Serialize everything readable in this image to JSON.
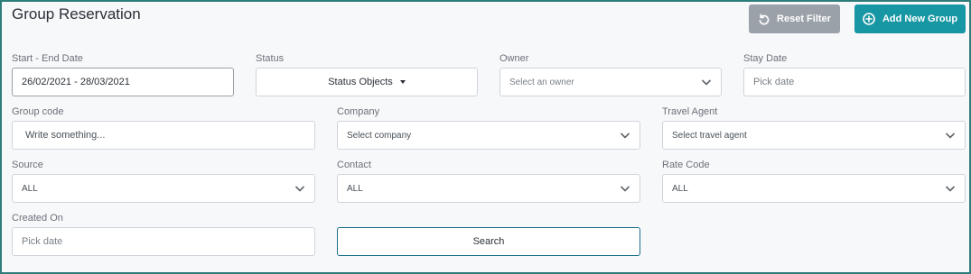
{
  "header": {
    "title": "Group Reservation",
    "reset_label": "Reset Filter",
    "add_label": "Add New Group"
  },
  "filters": {
    "date_range": {
      "label": "Start - End Date",
      "value": "26/02/2021 - 28/03/2021"
    },
    "status": {
      "label": "Status",
      "value": "Status Objects"
    },
    "owner": {
      "label": "Owner",
      "placeholder": "Select an owner"
    },
    "stay_date": {
      "label": "Stay Date",
      "placeholder": "Pick date"
    },
    "group_code": {
      "label": "Group code",
      "placeholder": "Write something..."
    },
    "company": {
      "label": "Company",
      "placeholder": "Select company"
    },
    "travel_agent": {
      "label": "Travel Agent",
      "placeholder": "Select travel agent"
    },
    "source": {
      "label": "Source",
      "value": "ALL"
    },
    "contact": {
      "label": "Contact",
      "value": "ALL"
    },
    "rate_code": {
      "label": "Rate Code",
      "value": "ALL"
    },
    "created_on": {
      "label": "Created On",
      "placeholder": "Pick date"
    }
  },
  "search_label": "Search",
  "colors": {
    "frame_border": "#2f7d7a",
    "reset_button": "#9aa1a8",
    "add_button": "#1796a3",
    "search_border": "#1a6f8a"
  },
  "icons": {
    "reset": "rotate-ccw-icon",
    "add": "plus-circle-icon",
    "dropdown": "chevron-down-icon",
    "caret": "caret-down-icon"
  }
}
